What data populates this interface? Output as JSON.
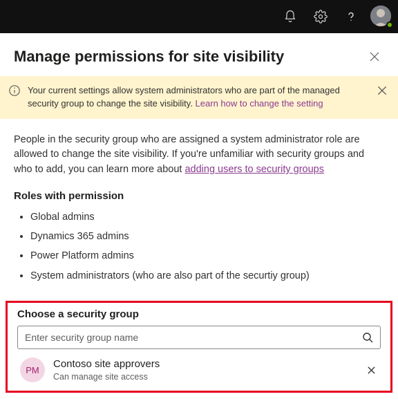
{
  "panel": {
    "title": "Manage permissions for site visibility"
  },
  "banner": {
    "text_prefix": "Your current settings allow system administrators who are part of the managed security group to change the site visibility. ",
    "link_text": "Learn how to change the setting"
  },
  "intro": {
    "text_prefix": "People in the security group who are assigned a system administrator role are allowed to change the site visibility. If you're unfamiliar with security groups and who to add, you can learn more about ",
    "link_text": "adding users to security groups"
  },
  "roles": {
    "heading": "Roles with permission",
    "items": [
      "Global admins",
      "Dynamics 365 admins",
      "Power Platform admins",
      "System administrators (who are also part of the securtiy group)"
    ]
  },
  "group_picker": {
    "heading": "Choose a security group",
    "placeholder": "Enter security group name",
    "selected": {
      "initials": "PM",
      "name": "Contoso site approvers",
      "subtitle": "Can manage site access"
    }
  }
}
